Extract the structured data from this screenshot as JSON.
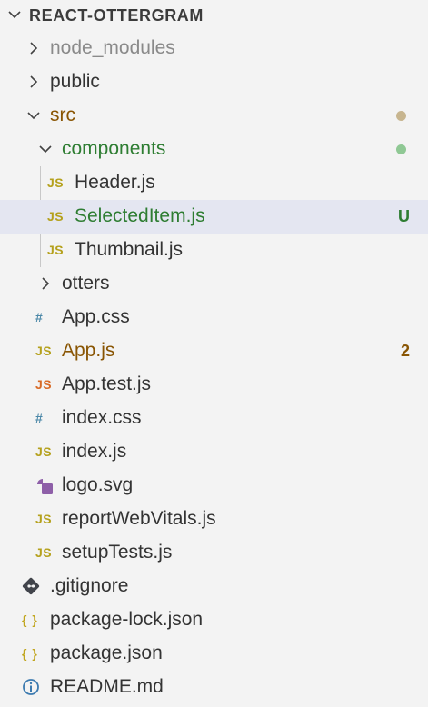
{
  "colors": {
    "background": "#f3f3f3",
    "selected_row": "#e4e6f1",
    "modified": "#895503",
    "untracked": "#2e7d32",
    "modified_dot": "#c7b58f",
    "untracked_dot": "#8fc894"
  },
  "explorer": {
    "title": "REACT-OTTERGRAM",
    "items": [
      {
        "label": "node_modules",
        "type": "folder",
        "expanded": false,
        "icon": "chevron-right-icon"
      },
      {
        "label": "public",
        "type": "folder",
        "expanded": false,
        "icon": "chevron-right-icon"
      },
      {
        "label": "src",
        "type": "folder",
        "expanded": true,
        "icon": "chevron-down-icon",
        "status": "modified-dot"
      },
      {
        "label": "components",
        "type": "folder",
        "expanded": true,
        "icon": "chevron-down-icon",
        "status": "untracked-dot"
      },
      {
        "label": "Header.js",
        "type": "file",
        "icon": "js-file-icon",
        "icon_text": "JS"
      },
      {
        "label": "SelectedItem.js",
        "type": "file",
        "icon": "js-file-icon",
        "icon_text": "JS",
        "status": "U",
        "selected": true
      },
      {
        "label": "Thumbnail.js",
        "type": "file",
        "icon": "js-file-icon",
        "icon_text": "JS"
      },
      {
        "label": "otters",
        "type": "folder",
        "expanded": false,
        "icon": "chevron-right-icon"
      },
      {
        "label": "App.css",
        "type": "file",
        "icon": "css-file-icon",
        "icon_text": "#"
      },
      {
        "label": "App.js",
        "type": "file",
        "icon": "js-file-icon",
        "icon_text": "JS",
        "status": "2"
      },
      {
        "label": "App.test.js",
        "type": "file",
        "icon": "test-js-file-icon",
        "icon_text": "JS"
      },
      {
        "label": "index.css",
        "type": "file",
        "icon": "css-file-icon",
        "icon_text": "#"
      },
      {
        "label": "index.js",
        "type": "file",
        "icon": "js-file-icon",
        "icon_text": "JS"
      },
      {
        "label": "logo.svg",
        "type": "file",
        "icon": "svg-file-icon"
      },
      {
        "label": "reportWebVitals.js",
        "type": "file",
        "icon": "js-file-icon",
        "icon_text": "JS"
      },
      {
        "label": "setupTests.js",
        "type": "file",
        "icon": "js-file-icon",
        "icon_text": "JS"
      },
      {
        "label": ".gitignore",
        "type": "file",
        "icon": "git-file-icon"
      },
      {
        "label": "package-lock.json",
        "type": "file",
        "icon": "json-file-icon",
        "icon_text": "{ }"
      },
      {
        "label": "package.json",
        "type": "file",
        "icon": "json-file-icon",
        "icon_text": "{ }"
      },
      {
        "label": "README.md",
        "type": "file",
        "icon": "info-icon"
      }
    ]
  }
}
